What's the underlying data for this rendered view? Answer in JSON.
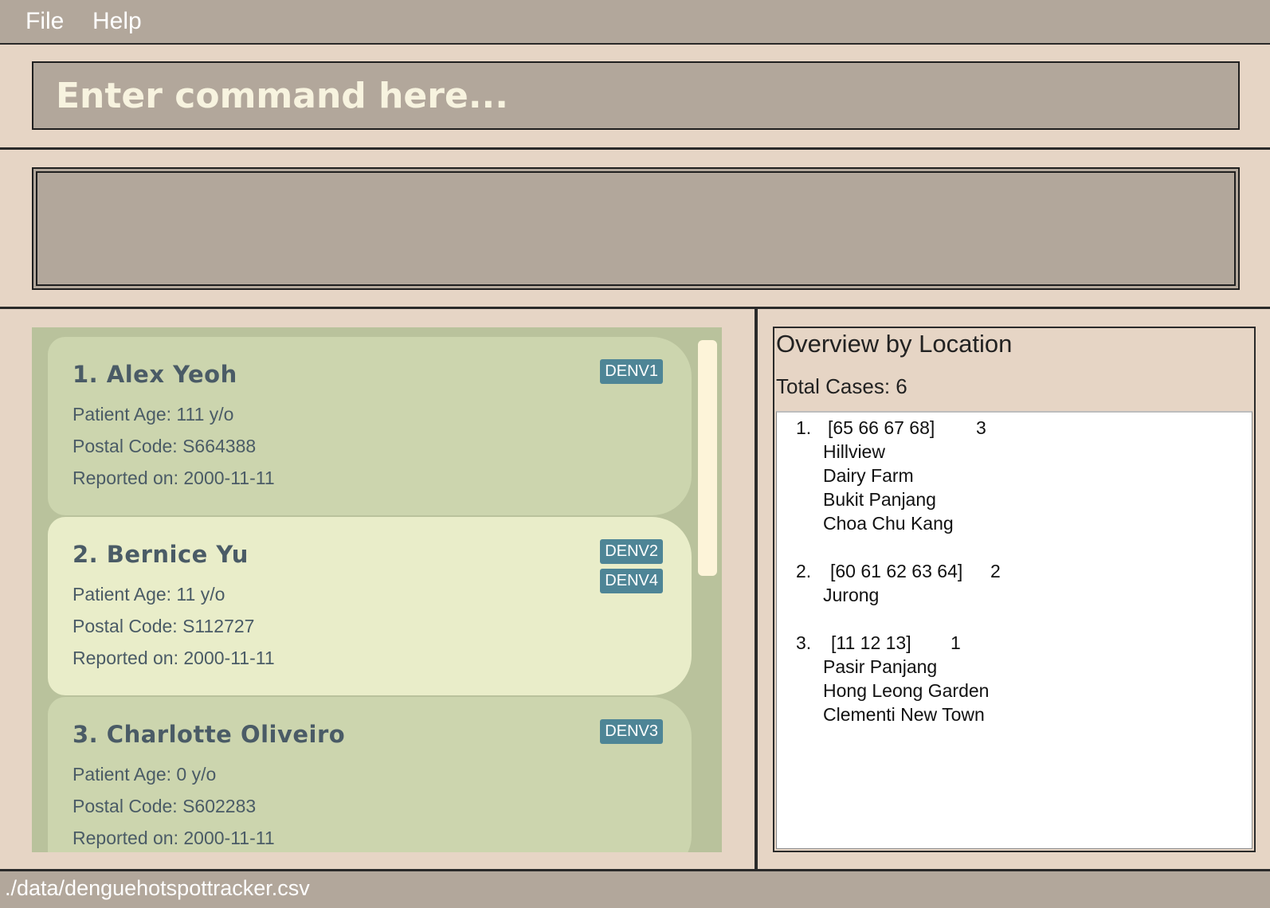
{
  "menu": {
    "file": "File",
    "help": "Help"
  },
  "command": {
    "placeholder": "Enter command here...",
    "value": ""
  },
  "result": {
    "text": ""
  },
  "persons": [
    {
      "name": "1. Alex Yeoh",
      "age": "Patient Age: 111 y/o",
      "postal": "Postal Code: S664388",
      "reported": "Reported on: 2000-11-11",
      "tags": [
        "DENV1"
      ]
    },
    {
      "name": "2. Bernice Yu",
      "age": "Patient Age: 11 y/o",
      "postal": "Postal Code: S112727",
      "reported": "Reported on: 2000-11-11",
      "tags": [
        "DENV2",
        "DENV4"
      ]
    },
    {
      "name": "3. Charlotte Oliveiro",
      "age": "Patient Age: 0 y/o",
      "postal": "Postal Code: S602283",
      "reported": "Reported on: 2000-11-11",
      "tags": [
        "DENV3"
      ]
    }
  ],
  "overview": {
    "title": "Overview by Location",
    "total": "Total Cases: 6",
    "groups": [
      {
        "index": "1.",
        "codes": "[65 66 67 68]",
        "count": "3",
        "places": [
          "Hillview",
          "Dairy Farm",
          "Bukit Panjang",
          "Choa Chu Kang"
        ]
      },
      {
        "index": "2.",
        "codes": "[60 61 62 63 64]",
        "count": "2",
        "places": [
          "Jurong"
        ]
      },
      {
        "index": "3.",
        "codes": "[11 12 13]",
        "count": "1",
        "places": [
          "Pasir Panjang",
          "Hong Leong Garden",
          "Clementi New Town"
        ]
      }
    ]
  },
  "status": {
    "path": "./data/denguehotspottracker.csv"
  },
  "colors": {
    "tag_bg": "#4e8596",
    "card_odd": "#ccd5ae",
    "card_even": "#e9edc9",
    "list_bg": "#b9c29c",
    "bar_bg": "#b2a79b",
    "panel_bg": "#e6d5c5"
  }
}
